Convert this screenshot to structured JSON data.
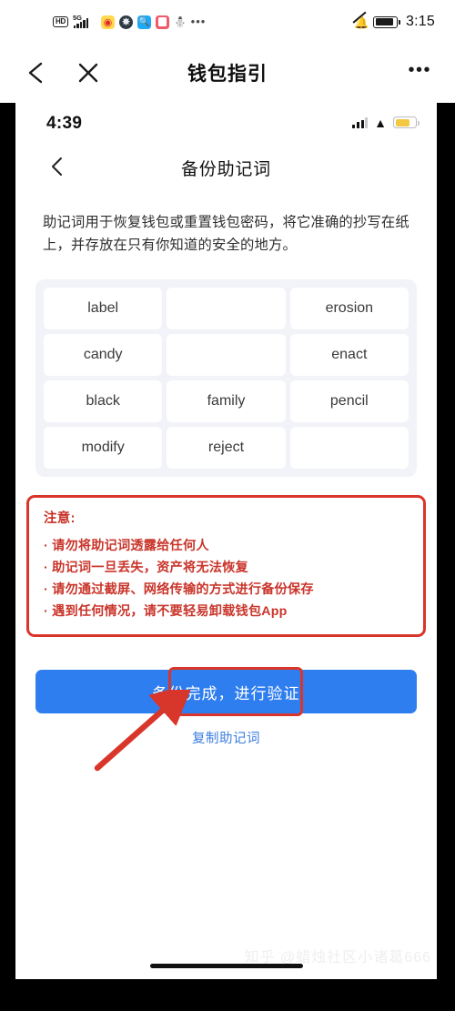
{
  "outer_status": {
    "hd_label": "HD",
    "network_label": "5G",
    "time": "3:15",
    "icons": [
      "hd-badge-icon",
      "signal-5g-icon",
      "weibo-app-icon",
      "globe-app-icon",
      "search-app-icon",
      "pink-app-icon",
      "gray-app-icon",
      "more-apps-icon"
    ],
    "right_icons": [
      "bell-mute-icon",
      "battery-icon"
    ]
  },
  "outer_nav": {
    "title": "钱包指引",
    "back_icon": "chevron-left-icon",
    "close_icon": "close-x-icon",
    "more_icon": "more-dots-icon"
  },
  "inner_status": {
    "time": "4:39",
    "icons": [
      "cellular-signal-icon",
      "wifi-icon",
      "battery-icon"
    ]
  },
  "inner_nav": {
    "title": "备份助记词",
    "back_icon": "chevron-left-icon"
  },
  "description": "助记词用于恢复钱包或重置钱包密码，将它准确的抄写在纸上，并存放在只有你知道的安全的地方。",
  "mnemonic_grid": {
    "columns": 3,
    "rows": 4,
    "cells": [
      "label",
      "",
      "erosion",
      "candy",
      "",
      "enact",
      "black",
      "family",
      "pencil",
      "modify",
      "reject",
      ""
    ]
  },
  "warning": {
    "title": "注意:",
    "items": [
      "· 请勿将助记词透露给任何人",
      "· 助记词一旦丢失，资产将无法恢复",
      "· 请勿通过截屏、网络传输的方式进行备份保存",
      "· 遇到任何情况，请不要轻易卸载钱包App"
    ],
    "border_color": "#d9362b",
    "text_color": "#c9352b"
  },
  "cta": {
    "button_label": "备份完成，进行验证",
    "button_color": "#2f7ef0",
    "highlight_color": "#d9362b",
    "link_label": "复制助记词",
    "link_color": "#3b7de0",
    "annotation_icon": "red-arrow-annotation"
  },
  "watermark": "知乎 @蜡烛社区小诸葛666"
}
